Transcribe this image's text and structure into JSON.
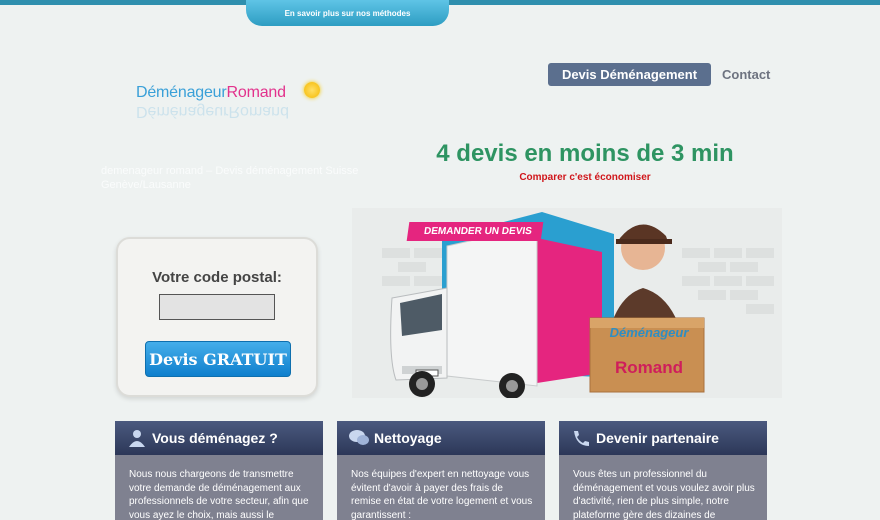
{
  "top_tab": {
    "label": "En savoir plus sur nos méthodes"
  },
  "logo": {
    "part1": "Déménageur",
    "part2": "Romand",
    "reflection": "DéménageurRomand"
  },
  "nav": {
    "devis_label": "Devis Déménagement",
    "contact_label": "Contact"
  },
  "tagline": "demenageur romand – Devis déménagement Suisse Genève/Lausanne",
  "headline": "4 devis en moins de 3 min",
  "subheadline": "Comparer c'est économiser",
  "postal": {
    "label": "Votre code postal:",
    "value": "",
    "button_label": "Devis GRATUIT"
  },
  "hero": {
    "tag": "DEMANDER UN DEVIS",
    "box_line1": "Déménageur",
    "box_line2": "Romand",
    "plate": "VD 123 456"
  },
  "cards": [
    {
      "title": "Vous déménagez ?",
      "icon": "person-icon",
      "body": "Nous nous chargeons de transmettre votre demande de déménagement aux professionnels de votre secteur, afin que vous ayez le choix, mais aussi le"
    },
    {
      "title": "Nettoyage",
      "icon": "chat-icon",
      "body": "Nos équipes d'expert en nettoyage vous évitent d'avoir à payer des frais de remise en état de votre logement et vous garantissent :"
    },
    {
      "title": "Devenir partenaire",
      "icon": "phone-icon",
      "body": "Vous êtes un professionnel du déménagement et vous voulez avoir plus d'activité, rien de plus simple, notre plateforme gère des dizaines de"
    }
  ],
  "colors": {
    "accent": "#2e9462",
    "danger": "#d0161b",
    "nav": "#5b6f8e",
    "button": "#1b8ad8",
    "card": "#7f8190"
  }
}
